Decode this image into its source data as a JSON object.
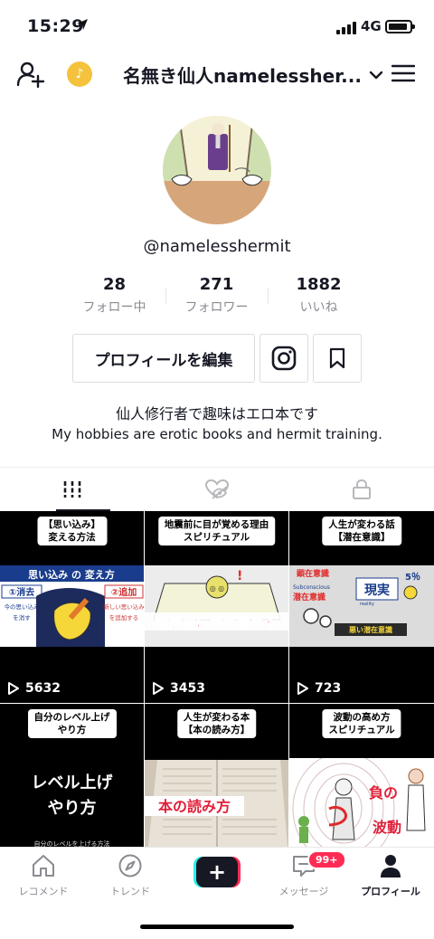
{
  "status_bar": {
    "time": "15:29",
    "network": "4G"
  },
  "top_nav": {
    "title": "名無き仙人namelessher..."
  },
  "profile": {
    "username": "@namelesshermit",
    "stats": [
      {
        "value": "28",
        "label": "フォロー中"
      },
      {
        "value": "271",
        "label": "フォロワー"
      },
      {
        "value": "1882",
        "label": "いいね"
      }
    ],
    "edit_button": "プロフィールを編集",
    "bio_line1": "仙人修行者で趣味はエロ本です",
    "bio_line2": "My hobbies are erotic books and hermit training."
  },
  "videos": [
    {
      "caption1": "【思い込み】",
      "caption2": "変える方法",
      "views": "5632",
      "thumb_title": "思い込み の 変え方",
      "thumb_a": "①消去",
      "thumb_b": "②追加",
      "thumb_c": "今の思い込み",
      "thumb_d": "を消す",
      "thumb_e": "新しい思い込み",
      "thumb_f": "を追加する"
    },
    {
      "caption1": "地震前に目が覚める理由",
      "caption2": "スピリチュアル",
      "views": "3453",
      "thumb_title": "地震前に目が覚める"
    },
    {
      "caption1": "人生が変わる話",
      "caption2": "【潜在意識】",
      "views": "723",
      "thumb_a": "顕在意識",
      "thumb_b": "潜在意識",
      "thumb_c": "Subconscious",
      "thumb_d": "現実",
      "thumb_e": "5％",
      "thumb_f": "悪い潜在意識",
      "thumb_g": "reality"
    },
    {
      "caption1": "自分のレベル上げ",
      "caption2": "やり方",
      "big1": "レベル上げ",
      "big2": "やり方",
      "small": "自分のレベルを上げる方法"
    },
    {
      "caption1": "人生が変わる本",
      "caption2": "【本の読み方】",
      "thumb_title": "本の読み方"
    },
    {
      "caption1": "波動の高め方",
      "caption2": "スピリチュアル",
      "thumb_a": "負の",
      "thumb_b": "波動"
    }
  ],
  "bottom_nav": {
    "items": [
      "レコメンド",
      "トレンド",
      "メッセージ",
      "プロフィール"
    ],
    "badge": "99+"
  },
  "colors": {
    "accent_red": "#fe2c55",
    "accent_cyan": "#25f4ee",
    "text": "#161823",
    "muted": "#8a8b91"
  }
}
